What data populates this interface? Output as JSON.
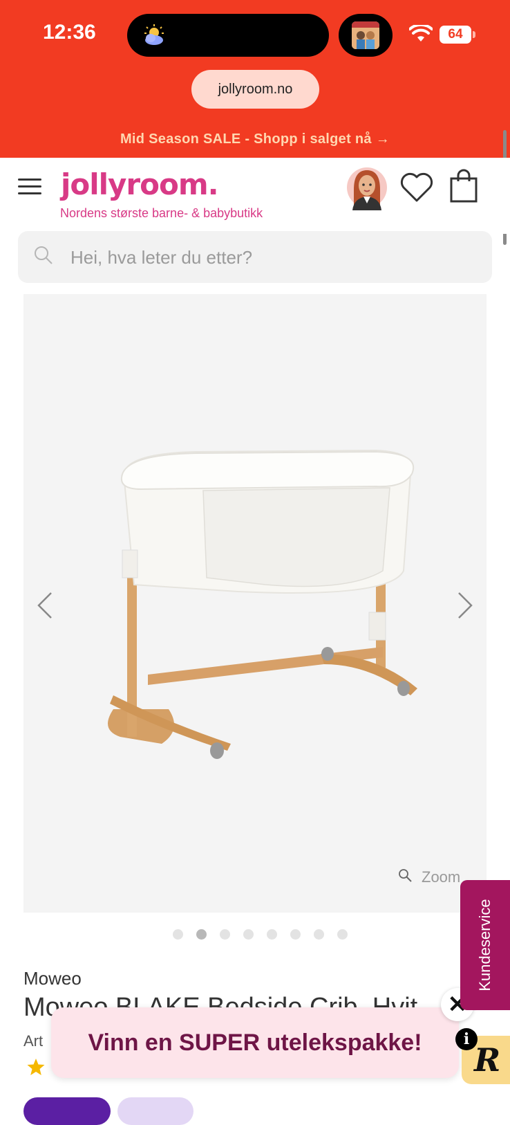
{
  "status_bar": {
    "time": "12:36",
    "battery": "64",
    "url": "jollyroom.no"
  },
  "promo_banner": "Mid Season SALE - Shopp i salget nå →",
  "header": {
    "logo": "jollyroom.",
    "tagline": "Nordens største barne- & babybutikk"
  },
  "search": {
    "placeholder": "Hei, hva leter du etter?"
  },
  "gallery": {
    "zoom_label": "Zoom",
    "total_images": 8,
    "active_index": 1
  },
  "product": {
    "brand": "Moweo",
    "title": "Moweo BLAKE Bedside Crib, Hvit",
    "article_prefix": "Art"
  },
  "popup": {
    "text": "Vinn en SUPER utelekspakke!",
    "close": "✕",
    "info": "i"
  },
  "customer_service": "Kundeservice",
  "reward_badge": "R",
  "colors": {
    "brand_red": "#f23b22",
    "brand_pink": "#d83a86",
    "popup_text": "#6e1546",
    "kundeservice": "#a3165e"
  }
}
